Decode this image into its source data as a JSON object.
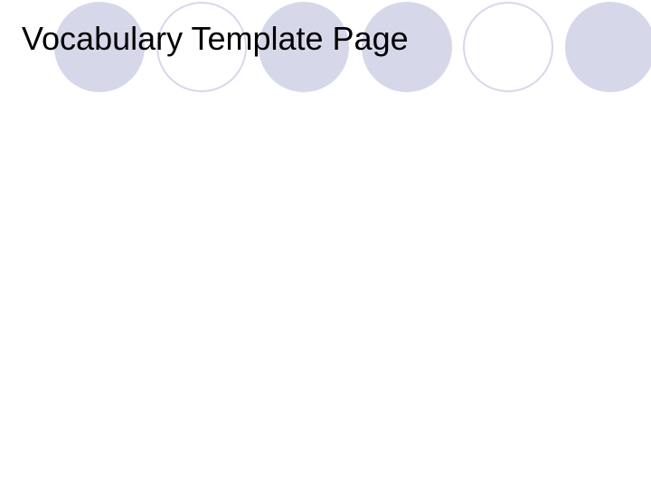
{
  "slide": {
    "title": "Vocabulary Template Page"
  }
}
